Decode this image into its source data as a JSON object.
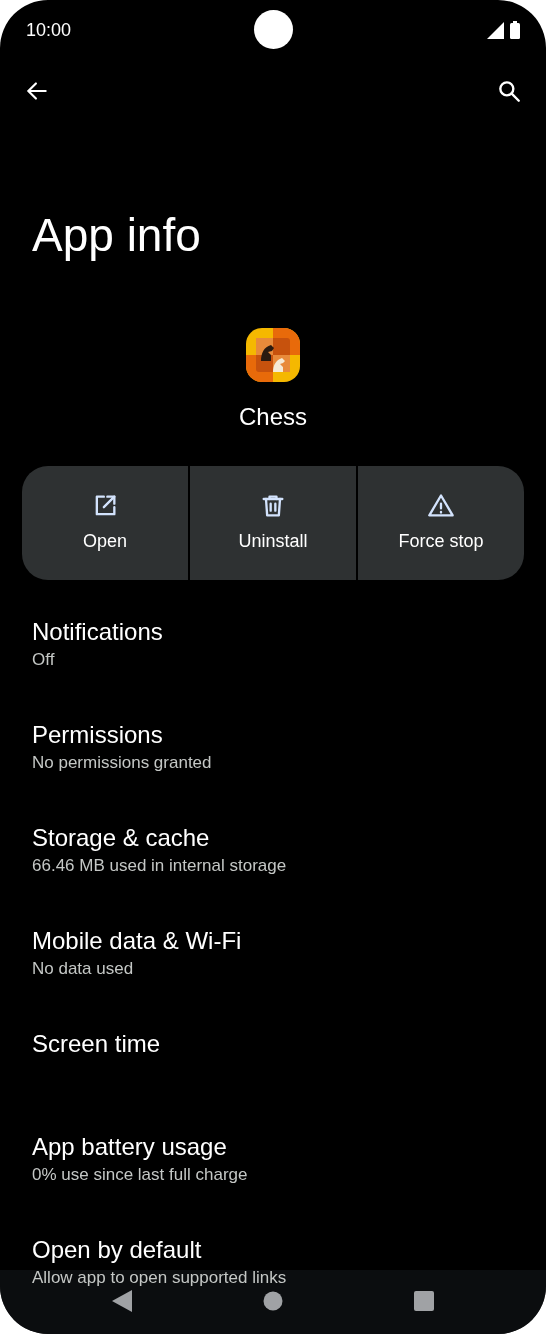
{
  "status_bar": {
    "time": "10:00"
  },
  "title": "App info",
  "app": {
    "name": "Chess"
  },
  "actions": [
    {
      "kind": "open",
      "label": "Open"
    },
    {
      "kind": "uninstall",
      "label": "Uninstall"
    },
    {
      "kind": "force_stop",
      "label": "Force stop"
    }
  ],
  "settings": [
    {
      "title": "Notifications",
      "subtitle": "Off"
    },
    {
      "title": "Permissions",
      "subtitle": "No permissions granted"
    },
    {
      "title": "Storage & cache",
      "subtitle": "66.46 MB used in internal storage"
    },
    {
      "title": "Mobile data & Wi-Fi",
      "subtitle": "No data used"
    },
    {
      "title": "Screen time"
    },
    {
      "title": "App battery usage",
      "subtitle": "0% use since last full charge"
    },
    {
      "title": "Open by default",
      "subtitle": "Allow app to open supported links"
    }
  ]
}
